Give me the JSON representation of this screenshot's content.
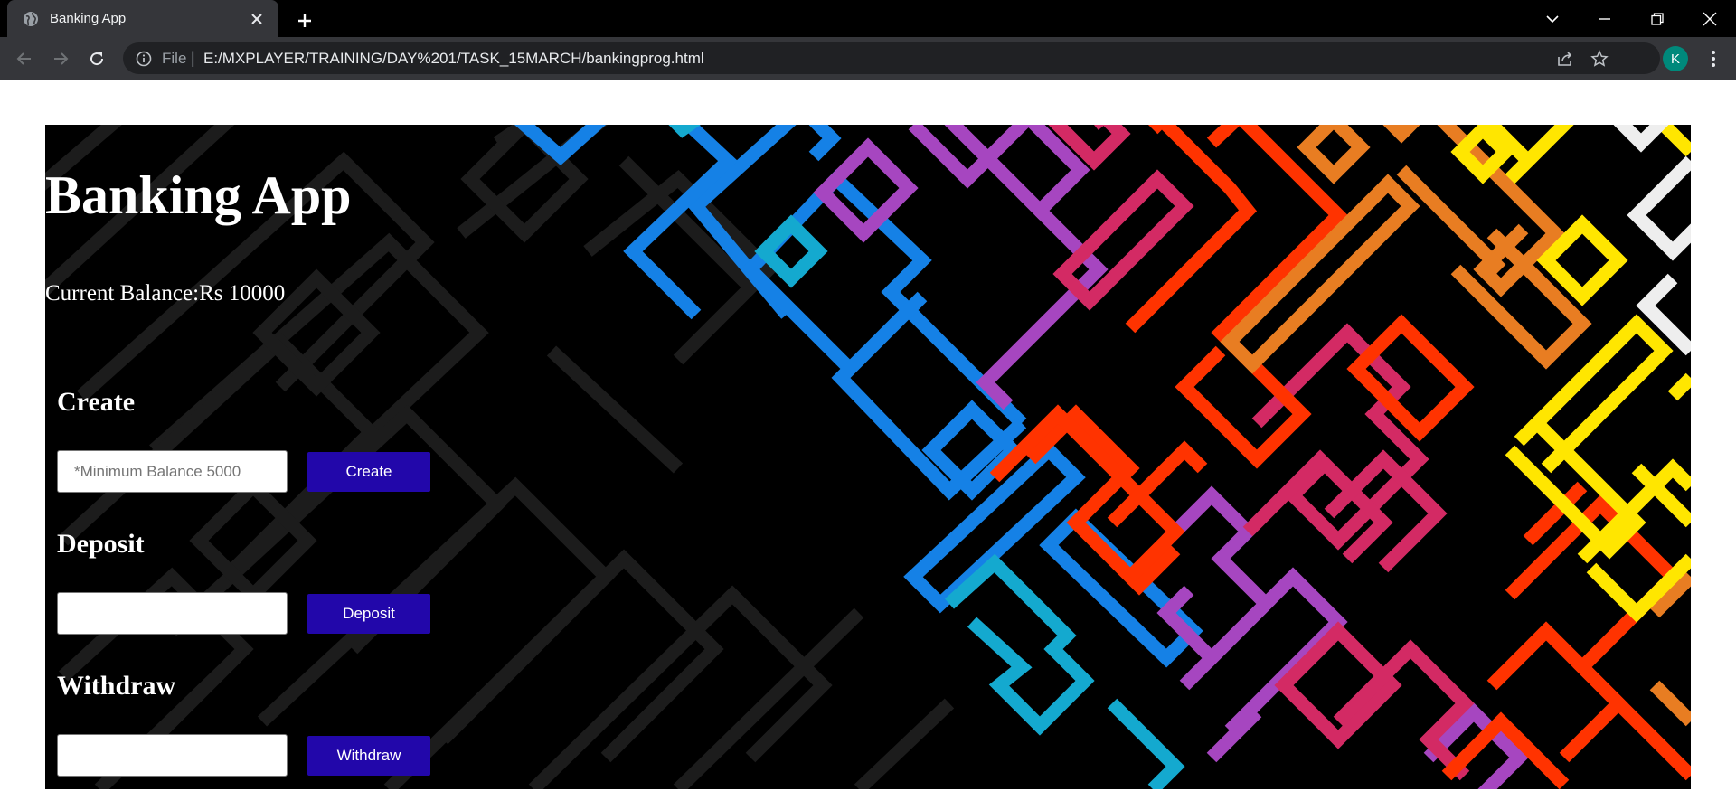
{
  "browser": {
    "tab_title": "Banking App",
    "address_scheme_label": "File",
    "url": "E:/MXPLAYER/TRAINING/DAY%201/TASK_15MARCH/bankingprog.html",
    "profile_initial": "K"
  },
  "app": {
    "title": "Banking App",
    "balance_text": "Current Balance:Rs 10000",
    "create": {
      "heading": "Create",
      "input_placeholder": "*Minimum Balance 5000",
      "input_value": "",
      "button_label": "Create"
    },
    "deposit": {
      "heading": "Deposit",
      "input_value": "",
      "button_label": "Deposit"
    },
    "withdraw": {
      "heading": "Withdraw",
      "input_value": "",
      "button_label": "Withdraw"
    }
  },
  "colors": {
    "button_bg": "#2207aa",
    "page_bg": "#000000",
    "maze_blue": "#1581e6",
    "maze_cyan": "#14a9cf",
    "maze_purple": "#a646c0",
    "maze_pink": "#d32a64",
    "maze_red": "#ff3300",
    "maze_orange": "#e87d22",
    "maze_yellow": "#ffe600",
    "maze_white": "#eeeeee"
  }
}
